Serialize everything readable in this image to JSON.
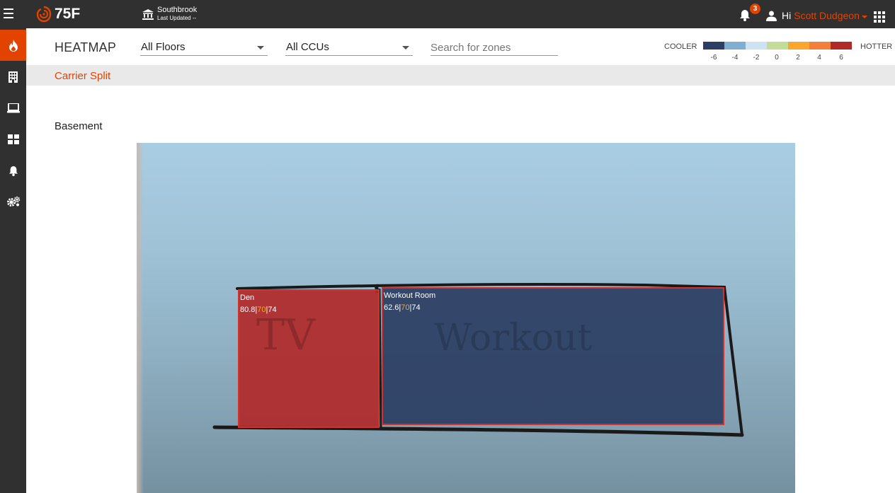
{
  "topbar": {
    "brand": "75F",
    "site_name": "Southbrook",
    "site_updated": "Last Updated --",
    "notification_count": "3",
    "greeting": "Hi",
    "user_name": "Scott Dudgeon"
  },
  "sidebar": {
    "items": [
      {
        "icon": "flame-icon",
        "active": true
      },
      {
        "icon": "building-icon",
        "active": false
      },
      {
        "icon": "laptop-icon",
        "active": false
      },
      {
        "icon": "dashboard-grid-icon",
        "active": false
      },
      {
        "icon": "bell-icon",
        "active": false
      },
      {
        "icon": "gears-icon",
        "active": false
      }
    ]
  },
  "header": {
    "title": "HEATMAP",
    "floor_select": "All Floors",
    "ccu_select": "All CCUs",
    "search_placeholder": "Search for zones",
    "legend": {
      "cooler_label": "COOLER",
      "hotter_label": "HOTTER",
      "colors": [
        "#2c3e63",
        "#80aed0",
        "#cde2f2",
        "#c3dd98",
        "#f9a62f",
        "#f27f3a",
        "#b02a2a"
      ],
      "ticks": [
        "-6",
        "-4",
        "-2",
        "0",
        "2",
        "4",
        "6"
      ]
    }
  },
  "site_group": {
    "title": "Carrier Split"
  },
  "floor": {
    "name": "Basement",
    "zones": [
      {
        "name": "Den",
        "current": "80.8",
        "sep1": "|",
        "setpoint": "70",
        "sep2": "|",
        "target": "74",
        "color": "#b02a2a",
        "sketch_text": "TV"
      },
      {
        "name": "Workout Room",
        "current": "62.6",
        "sep1": "|",
        "setpoint": "70",
        "sep2": "|",
        "target": "74",
        "color": "#2c3e63",
        "sketch_text": "Workout"
      }
    ]
  }
}
